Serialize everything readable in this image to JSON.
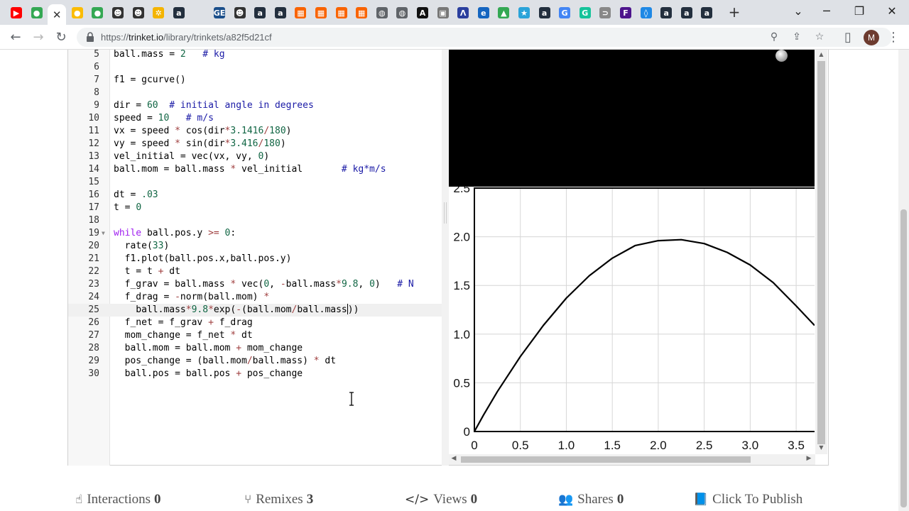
{
  "browser": {
    "url_prefix": "https://",
    "url_host": "trinket.io",
    "url_path": "/library/trinkets/a82f5d21cf",
    "avatar_letter": "M",
    "tabs": [
      {
        "icon": "youtube-icon",
        "color": "#ff0000",
        "glyph": "▶"
      },
      {
        "icon": "chrome-icon",
        "color": "#34a853",
        "glyph": "●"
      },
      {
        "icon": "close-icon",
        "color": "",
        "glyph": "✕",
        "active": true
      },
      {
        "icon": "chrome-icon",
        "color": "#fbbc05",
        "glyph": "●"
      },
      {
        "icon": "chrome-icon",
        "color": "#34a853",
        "glyph": "●"
      },
      {
        "icon": "bearded-avatar-icon",
        "color": "#333333",
        "glyph": "☻"
      },
      {
        "icon": "bearded-avatar-icon",
        "color": "#333333",
        "glyph": "☻"
      },
      {
        "icon": "sun-icon",
        "color": "#f4b400",
        "glyph": "✲"
      },
      {
        "icon": "amazon-icon",
        "color": "#232f3e",
        "glyph": "a"
      },
      {
        "icon": "blank-icon",
        "color": "#dee1e6",
        "glyph": ""
      },
      {
        "icon": "ge-icon",
        "color": "#1a4e8a",
        "glyph": "GE"
      },
      {
        "icon": "bearded-avatar-icon",
        "color": "#333333",
        "glyph": "☻"
      },
      {
        "icon": "amazon-icon",
        "color": "#232f3e",
        "glyph": "a"
      },
      {
        "icon": "amazon-icon",
        "color": "#232f3e",
        "glyph": "a"
      },
      {
        "icon": "home-depot-icon",
        "color": "#f96302",
        "glyph": "▦"
      },
      {
        "icon": "home-depot-icon",
        "color": "#f96302",
        "glyph": "▦"
      },
      {
        "icon": "home-depot-icon",
        "color": "#f96302",
        "glyph": "▦"
      },
      {
        "icon": "home-depot-icon",
        "color": "#f96302",
        "glyph": "▦"
      },
      {
        "icon": "globe-icon",
        "color": "#5f6368",
        "glyph": "◍"
      },
      {
        "icon": "globe-icon",
        "color": "#5f6368",
        "glyph": "◍"
      },
      {
        "icon": "a-logo-icon",
        "color": "#111111",
        "glyph": "A"
      },
      {
        "icon": "image-icon",
        "color": "#777777",
        "glyph": "▣"
      },
      {
        "icon": "mountain-logo-icon",
        "color": "#2b3f9e",
        "glyph": "Λ"
      },
      {
        "icon": "e-logo-icon",
        "color": "#1565c0",
        "glyph": "e"
      },
      {
        "icon": "drive-icon",
        "color": "#34a853",
        "glyph": "▲"
      },
      {
        "icon": "star-box-icon",
        "color": "#2aa3d9",
        "glyph": "★"
      },
      {
        "icon": "amazon-icon",
        "color": "#232f3e",
        "glyph": "a"
      },
      {
        "icon": "google-icon",
        "color": "#4285f4",
        "glyph": "G"
      },
      {
        "icon": "grammarly-icon",
        "color": "#15c39a",
        "glyph": "G"
      },
      {
        "icon": "arrow-icon",
        "color": "#888888",
        "glyph": "⊃"
      },
      {
        "icon": "fedex-icon",
        "color": "#4d148c",
        "glyph": "F"
      },
      {
        "icon": "drop-icon",
        "color": "#1e88e5",
        "glyph": "◊"
      },
      {
        "icon": "amazon-icon",
        "color": "#232f3e",
        "glyph": "a"
      },
      {
        "icon": "amazon-icon",
        "color": "#232f3e",
        "glyph": "a"
      },
      {
        "icon": "amazon-icon",
        "color": "#232f3e",
        "glyph": "a"
      }
    ]
  },
  "editor": {
    "lines": [
      {
        "n": "5",
        "code": [
          [
            "ball.mass = ",
            ""
          ],
          [
            "2",
            "num"
          ],
          [
            "   # kg",
            "cm"
          ]
        ]
      },
      {
        "n": "6",
        "code": []
      },
      {
        "n": "7",
        "code": [
          [
            "f1 = gcurve()",
            ""
          ]
        ]
      },
      {
        "n": "8",
        "code": []
      },
      {
        "n": "9",
        "code": [
          [
            "dir = ",
            ""
          ],
          [
            "60",
            "num"
          ],
          [
            "  # initial angle in degrees",
            "cm"
          ]
        ]
      },
      {
        "n": "10",
        "code": [
          [
            "speed = ",
            ""
          ],
          [
            "10",
            "num"
          ],
          [
            "   # m/s",
            "cm"
          ]
        ]
      },
      {
        "n": "11",
        "code": [
          [
            "vx = speed ",
            ""
          ],
          [
            "*",
            "op"
          ],
          [
            " cos(dir",
            ""
          ],
          [
            "*",
            "op"
          ],
          [
            "3.1416",
            "num"
          ],
          [
            "/",
            "op"
          ],
          [
            "180",
            "num"
          ],
          [
            ")",
            ""
          ]
        ]
      },
      {
        "n": "12",
        "code": [
          [
            "vy = speed ",
            ""
          ],
          [
            "*",
            "op"
          ],
          [
            " sin(dir",
            ""
          ],
          [
            "*",
            "op"
          ],
          [
            "3.416",
            "num"
          ],
          [
            "/",
            "op"
          ],
          [
            "180",
            "num"
          ],
          [
            ")",
            ""
          ]
        ]
      },
      {
        "n": "13",
        "code": [
          [
            "vel_initial = vec(vx, vy, ",
            ""
          ],
          [
            "0",
            "num"
          ],
          [
            ")",
            ""
          ]
        ]
      },
      {
        "n": "14",
        "code": [
          [
            "ball.mom = ball.mass ",
            ""
          ],
          [
            "*",
            "op"
          ],
          [
            " vel_initial       ",
            ""
          ],
          [
            "# kg*m/s",
            "cm"
          ]
        ]
      },
      {
        "n": "15",
        "code": []
      },
      {
        "n": "16",
        "code": [
          [
            "dt = ",
            ""
          ],
          [
            ".03",
            "num"
          ]
        ]
      },
      {
        "n": "17",
        "code": [
          [
            "t = ",
            ""
          ],
          [
            "0",
            "num"
          ]
        ]
      },
      {
        "n": "18",
        "code": []
      },
      {
        "n": "19",
        "fold": true,
        "code": [
          [
            "while",
            "kw"
          ],
          [
            " ball.pos.y ",
            ""
          ],
          [
            ">=",
            "op"
          ],
          [
            " ",
            ""
          ],
          [
            "0",
            "num"
          ],
          [
            ":",
            ""
          ]
        ]
      },
      {
        "n": "20",
        "code": [
          [
            "  rate(",
            ""
          ],
          [
            "33",
            "num"
          ],
          [
            ")",
            ""
          ]
        ]
      },
      {
        "n": "21",
        "code": [
          [
            "  f1.plot(ball.pos.x,ball.pos.y)",
            ""
          ]
        ]
      },
      {
        "n": "22",
        "code": [
          [
            "  t = t ",
            ""
          ],
          [
            "+",
            "op"
          ],
          [
            " dt",
            ""
          ]
        ]
      },
      {
        "n": "23",
        "code": [
          [
            "  f_grav = ball.mass ",
            ""
          ],
          [
            "*",
            "op"
          ],
          [
            " vec(",
            ""
          ],
          [
            "0",
            "num"
          ],
          [
            ", ",
            ""
          ],
          [
            "-",
            "op"
          ],
          [
            "ball.mass",
            ""
          ],
          [
            "*",
            "op"
          ],
          [
            "9.8",
            "num"
          ],
          [
            ", ",
            ""
          ],
          [
            "0",
            "num"
          ],
          [
            ")   ",
            ""
          ],
          [
            "# N",
            "cm"
          ]
        ]
      },
      {
        "n": "24",
        "code": [
          [
            "  f_drag = ",
            ""
          ],
          [
            "-",
            "op"
          ],
          [
            "norm(ball.mom) ",
            ""
          ],
          [
            "*",
            "op"
          ]
        ]
      },
      {
        "n": "25",
        "active": true,
        "code": [
          [
            "    ball.mass",
            ""
          ],
          [
            "*",
            "op"
          ],
          [
            "9.8",
            "num"
          ],
          [
            "*",
            "op"
          ],
          [
            "exp(",
            ""
          ],
          [
            "-",
            "op"
          ],
          [
            "(ball.mom",
            ""
          ],
          [
            "/",
            "op"
          ],
          [
            "ball.mass",
            ""
          ],
          [
            "|",
            "caret"
          ],
          [
            "))",
            ""
          ]
        ]
      },
      {
        "n": "26",
        "code": [
          [
            "  f_net = f_grav ",
            ""
          ],
          [
            "+",
            "op"
          ],
          [
            " f_drag",
            ""
          ]
        ]
      },
      {
        "n": "27",
        "code": [
          [
            "  mom_change = f_net ",
            ""
          ],
          [
            "*",
            "op"
          ],
          [
            " dt",
            ""
          ]
        ]
      },
      {
        "n": "28",
        "code": [
          [
            "  ball.mom = ball.mom ",
            ""
          ],
          [
            "+",
            "op"
          ],
          [
            " mom_change",
            ""
          ]
        ]
      },
      {
        "n": "29",
        "code": [
          [
            "  pos_change = (ball.mom",
            ""
          ],
          [
            "/",
            "op"
          ],
          [
            "ball.mass) ",
            ""
          ],
          [
            "*",
            "op"
          ],
          [
            " dt",
            ""
          ]
        ]
      },
      {
        "n": "30",
        "code": [
          [
            "  ball.pos = ball.pos ",
            ""
          ],
          [
            "+",
            "op"
          ],
          [
            " pos_change",
            ""
          ]
        ]
      }
    ]
  },
  "chart_data": {
    "type": "line",
    "xlim": [
      0,
      3.7
    ],
    "ylim": [
      0,
      2.5
    ],
    "x_ticks": [
      "0",
      "0.5",
      "1.0",
      "1.5",
      "2.0",
      "2.5",
      "3.0",
      "3.5"
    ],
    "y_ticks": [
      "0",
      "0.5",
      "1.0",
      "1.5",
      "2.0",
      "2.5"
    ],
    "grid": true,
    "series": [
      {
        "x": [
          0,
          0.1,
          0.25,
          0.5,
          0.75,
          1.0,
          1.25,
          1.5,
          1.75,
          2.0,
          2.25,
          2.5,
          2.75,
          3.0,
          3.25,
          3.5,
          3.7
        ],
        "y": [
          0,
          0.17,
          0.41,
          0.77,
          1.09,
          1.37,
          1.6,
          1.78,
          1.91,
          1.96,
          1.97,
          1.93,
          1.84,
          1.71,
          1.53,
          1.29,
          1.09
        ]
      }
    ]
  },
  "footer": {
    "interactions_label": "Interactions",
    "interactions_count": "0",
    "remixes_label": "Remixes",
    "remixes_count": "3",
    "views_label": "Views",
    "views_count": "0",
    "shares_label": "Shares",
    "shares_count": "0",
    "publish_label": "Click To Publish"
  }
}
